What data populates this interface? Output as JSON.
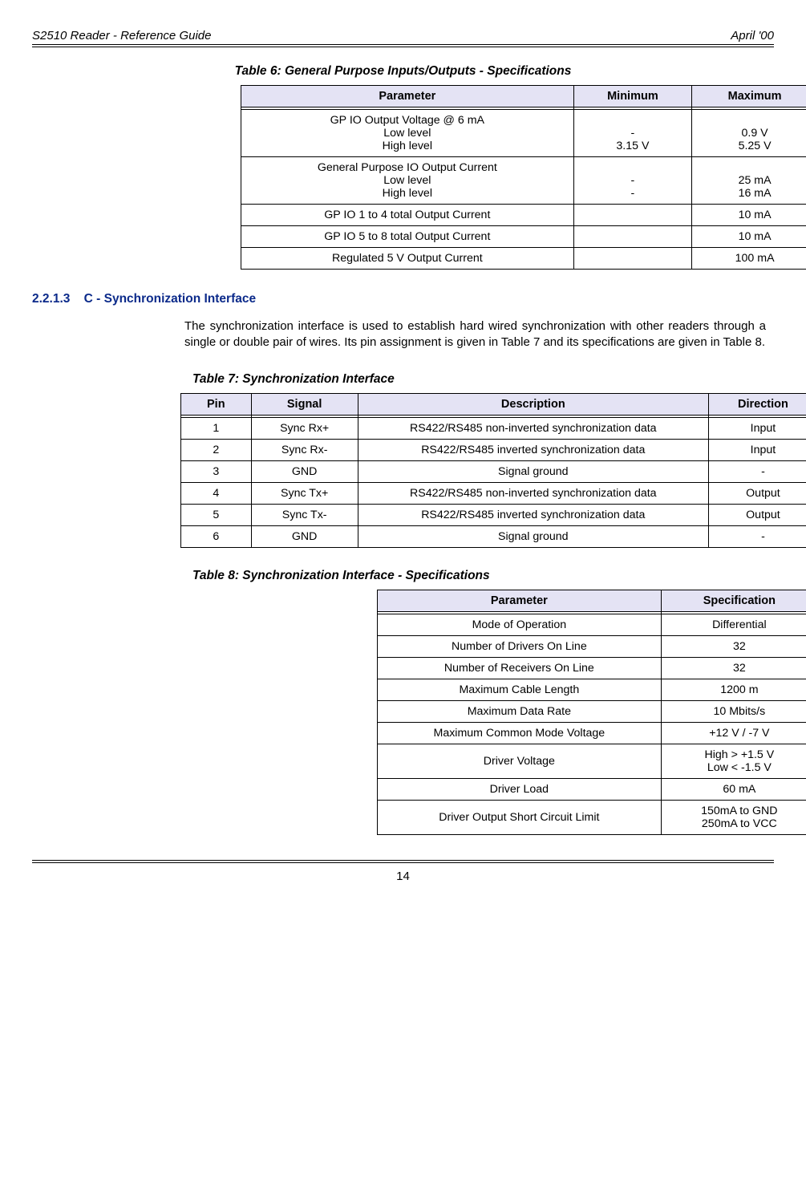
{
  "header": {
    "left": "S2510 Reader - Reference Guide",
    "right": "April '00"
  },
  "table6": {
    "caption": "Table 6: General Purpose Inputs/Outputs - Specifications",
    "headers": [
      "Parameter",
      "Minimum",
      "Maximum"
    ],
    "rows": [
      {
        "param_lines": [
          "GP IO Output Voltage @ 6 mA",
          "Low level",
          "High level"
        ],
        "min_lines": [
          "",
          "-",
          "3.15 V"
        ],
        "max_lines": [
          "",
          "0.9 V",
          "5.25 V"
        ]
      },
      {
        "param_lines": [
          "General Purpose IO Output Current",
          "Low level",
          "High level"
        ],
        "min_lines": [
          "",
          "-",
          "-"
        ],
        "max_lines": [
          "",
          "25 mA",
          "16 mA"
        ]
      },
      {
        "param_lines": [
          "GP IO 1 to 4 total Output Current"
        ],
        "min_lines": [
          ""
        ],
        "max_lines": [
          "10 mA"
        ]
      },
      {
        "param_lines": [
          "GP IO 5 to 8 total Output Current"
        ],
        "min_lines": [
          ""
        ],
        "max_lines": [
          "10 mA"
        ]
      },
      {
        "param_lines": [
          "Regulated 5 V Output Current"
        ],
        "min_lines": [
          ""
        ],
        "max_lines": [
          "100 mA"
        ]
      }
    ]
  },
  "section": {
    "number": "2.2.1.3",
    "title": "C - Synchronization Interface",
    "paragraph": "The synchronization interface is used to establish hard wired synchronization with other readers through a single or double pair of wires. Its pin assignment is given in Table 7 and its specifications are given in Table 8."
  },
  "table7": {
    "caption": "Table 7: Synchronization Interface",
    "headers": [
      "Pin",
      "Signal",
      "Description",
      "Direction"
    ],
    "rows": [
      [
        "1",
        "Sync Rx+",
        "RS422/RS485 non-inverted synchronization data",
        "Input"
      ],
      [
        "2",
        "Sync Rx-",
        "RS422/RS485 inverted synchronization data",
        "Input"
      ],
      [
        "3",
        "GND",
        "Signal ground",
        "-"
      ],
      [
        "4",
        "Sync Tx+",
        "RS422/RS485 non-inverted synchronization data",
        "Output"
      ],
      [
        "5",
        "Sync Tx-",
        "RS422/RS485 inverted synchronization data",
        "Output"
      ],
      [
        "6",
        "GND",
        "Signal ground",
        "-"
      ]
    ]
  },
  "table8": {
    "caption": "Table 8: Synchronization Interface - Specifications",
    "headers": [
      "Parameter",
      "Specification"
    ],
    "rows": [
      [
        "Mode of Operation",
        "Differential"
      ],
      [
        "Number of Drivers On Line",
        "32"
      ],
      [
        "Number of Receivers On Line",
        "32"
      ],
      [
        "Maximum Cable Length",
        "1200 m"
      ],
      [
        "Maximum Data Rate",
        "10 Mbits/s"
      ],
      [
        "Maximum Common Mode Voltage",
        "+12 V / -7 V"
      ],
      [
        "Driver Voltage",
        "High > +1.5 V\nLow < -1.5 V"
      ],
      [
        "Driver Load",
        "60 mA"
      ],
      [
        "Driver Output Short Circuit Limit",
        "150mA to GND\n250mA to VCC"
      ]
    ]
  },
  "footer": {
    "page": "14"
  }
}
